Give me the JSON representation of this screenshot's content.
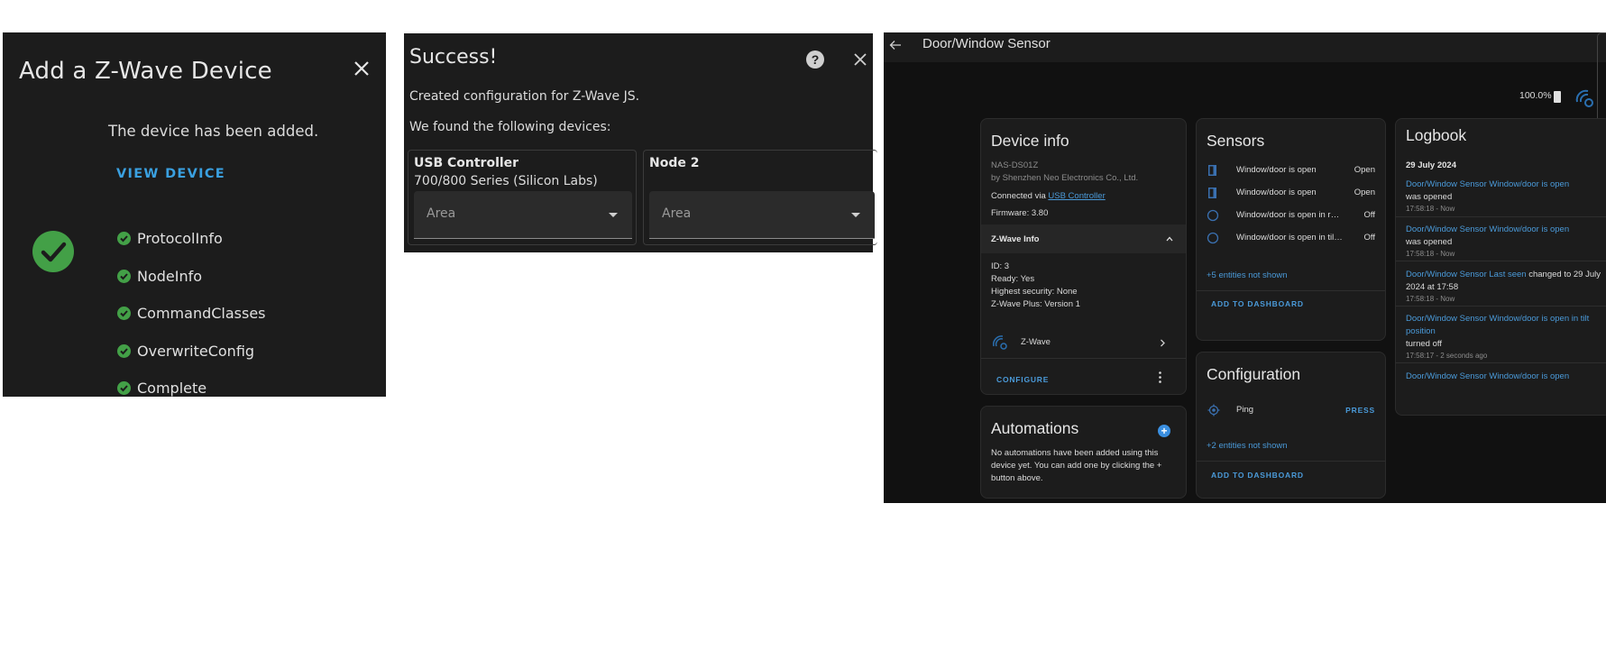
{
  "panel1": {
    "title": "Add a Z-Wave Device",
    "message": "The device has been added.",
    "view_device": "VIEW DEVICE",
    "steps": [
      "ProtocolInfo",
      "NodeInfo",
      "CommandClasses",
      "OverwriteConfig",
      "Complete"
    ],
    "accent": "#43a047"
  },
  "panel2": {
    "title": "Success!",
    "help": "?",
    "line1": "Created configuration for Z-Wave JS.",
    "line2": "We found the following devices:",
    "devices": [
      {
        "name": "USB Controller",
        "sub": "700/800 Series (Silicon Labs)",
        "area_placeholder": "Area"
      },
      {
        "name": "Node 2",
        "sub": "",
        "area_placeholder": "Area"
      }
    ]
  },
  "panel3": {
    "title": "Door/Window Sensor",
    "battery": "100.0%",
    "device_info": {
      "title": "Device info",
      "model": "NAS-DS01Z",
      "manufacturer": "by Shenzhen Neo Electronics Co., Ltd.",
      "connected_prefix": "Connected via ",
      "connected_link": "USB Controller",
      "firmware": "Firmware: 3.80",
      "zwave_info_label": "Z-Wave Info",
      "zwave_lines": [
        "ID: 3",
        "Ready: Yes",
        "Highest security: None",
        "Z-Wave Plus: Version 1"
      ],
      "integration": "Z-Wave",
      "configure": "CONFIGURE"
    },
    "automations": {
      "title": "Automations",
      "text": "No automations have been added using this device yet. You can add one by clicking the + button above."
    },
    "sensors": {
      "title": "Sensors",
      "rows": [
        {
          "name": "Window/door is open",
          "state": "Open"
        },
        {
          "name": "Window/door is open",
          "state": "Open"
        },
        {
          "name": "Window/door is open in regular position",
          "state": "Off"
        },
        {
          "name": "Window/door is open in tilt position",
          "state": "Off"
        }
      ],
      "more": "+5 entities not shown",
      "add": "ADD TO DASHBOARD"
    },
    "configuration": {
      "title": "Configuration",
      "ping": "Ping",
      "press": "PRESS",
      "more": "+2 entities not shown",
      "add": "ADD TO DASHBOARD"
    },
    "logbook": {
      "title": "Logbook",
      "date": "29 July 2024",
      "entries": [
        {
          "link": "Door/Window Sensor Window/door is open",
          "text": "was opened",
          "time": "17:58:18 - Now"
        },
        {
          "link": "Door/Window Sensor Window/door is open",
          "text": "was opened",
          "time": "17:58:18 - Now"
        },
        {
          "link": "Door/Window Sensor Last seen",
          "text": " changed to 29 July 2024 at 17:58",
          "time": "17:58:18 - Now"
        },
        {
          "link": "Door/Window Sensor Window/door is open in tilt position",
          "text": "turned off",
          "time": "17:58:17 - 2 seconds ago"
        },
        {
          "link": "Door/Window Sensor Window/door is open",
          "text": "",
          "time": ""
        }
      ]
    },
    "link_color": "#4a9ad9"
  }
}
